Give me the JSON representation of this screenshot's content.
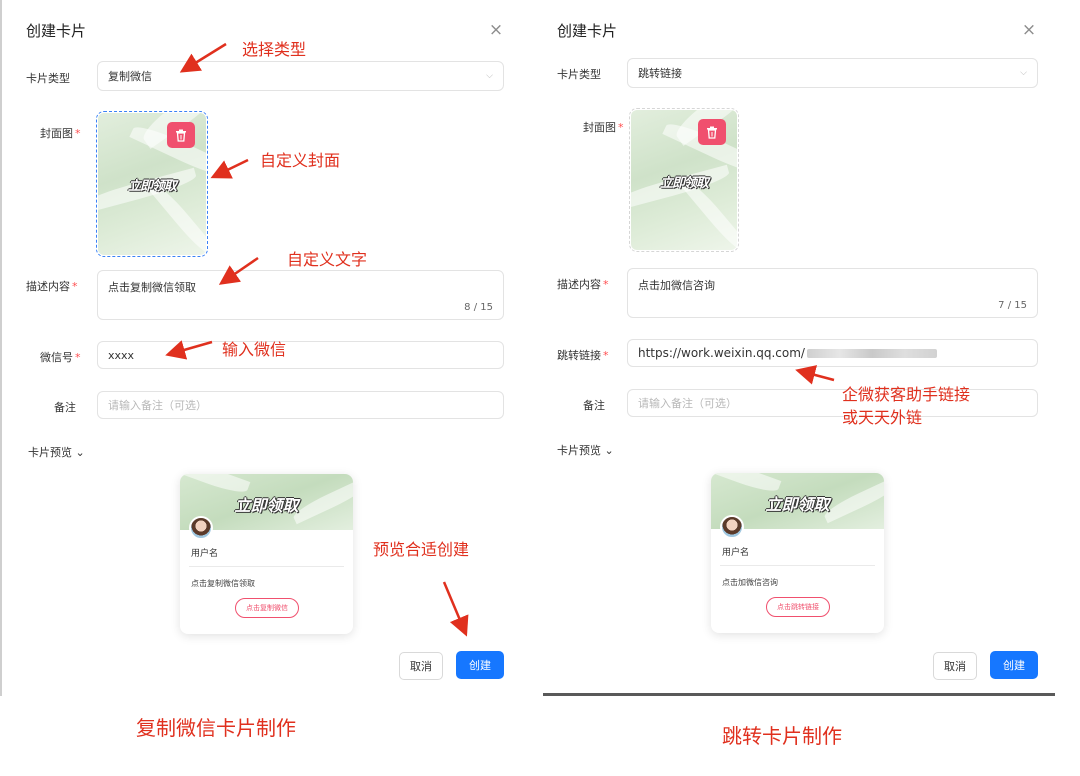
{
  "left": {
    "dialog_title": "创建卡片",
    "close_symbol": "×",
    "card_type": {
      "label": "卡片类型",
      "value": "复制微信"
    },
    "cover": {
      "label": "封面图",
      "required": "*",
      "image_text": "立即领取"
    },
    "description": {
      "label": "描述内容",
      "required": "*",
      "value": "点击复制微信领取",
      "counter": "8 / 15"
    },
    "wechat": {
      "label": "微信号",
      "required": "*",
      "value": "xxxx"
    },
    "remark": {
      "label": "备注",
      "placeholder": "请输入备注（可选）"
    },
    "preview_toggle": "卡片预览",
    "preview_card": {
      "banner_text": "立即领取",
      "username": "用户名",
      "description": "点击复制微信领取",
      "button": "点击复制微信"
    },
    "cancel_button": "取消",
    "create_button": "创建",
    "caption": "复制微信卡片制作"
  },
  "right": {
    "dialog_title": "创建卡片",
    "close_symbol": "×",
    "card_type": {
      "label": "卡片类型",
      "value": "跳转链接"
    },
    "cover": {
      "label": "封面图",
      "required": "*",
      "image_text": "立即领取"
    },
    "description": {
      "label": "描述内容",
      "required": "*",
      "value": "点击加微信咨询",
      "counter": "7 / 15"
    },
    "link": {
      "label": "跳转链接",
      "required": "*",
      "value": "https://work.weixin.qq.com/"
    },
    "remark": {
      "label": "备注",
      "placeholder": "请输入备注（可选）"
    },
    "preview_toggle": "卡片预览",
    "preview_card": {
      "banner_text": "立即领取",
      "username": "用户名",
      "description": "点击加微信咨询",
      "button": "点击跳转链接"
    },
    "cancel_button": "取消",
    "create_button": "创建",
    "caption": "跳转卡片制作"
  },
  "annotations": {
    "select_type": "选择类型",
    "custom_cover": "自定义封面",
    "custom_text": "自定义文字",
    "input_wechat": "输入微信",
    "preview_create": "预览合适创建",
    "link_hint_line1": "企微获客助手链接",
    "link_hint_line2": "或天天外链"
  },
  "colors": {
    "annotation": "#e0301e",
    "primary": "#1677ff",
    "required": "#ff4d4f",
    "trash": "#f0506e"
  },
  "icons": [
    "close-icon",
    "chevron-down-icon",
    "trash-icon",
    "avatar"
  ]
}
